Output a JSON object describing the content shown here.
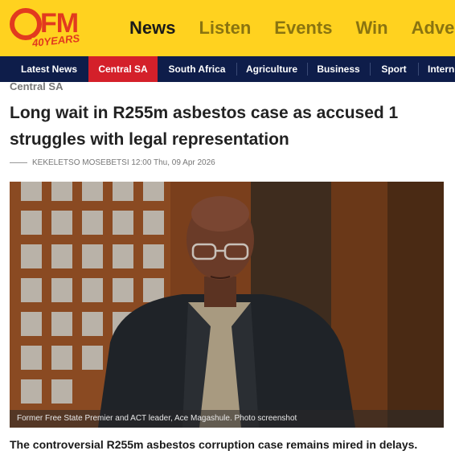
{
  "header": {
    "logo": {
      "letters": "OFM",
      "tagline": "40YEARS"
    },
    "nav": [
      {
        "label": "News",
        "active": true
      },
      {
        "label": "Listen",
        "active": false
      },
      {
        "label": "Events",
        "active": false
      },
      {
        "label": "Win",
        "active": false
      },
      {
        "label": "Adver",
        "active": false
      }
    ],
    "brand_color": "#ffd21f",
    "accent_color": "#e23a1f"
  },
  "categories": [
    {
      "label": "Latest News",
      "active": false
    },
    {
      "label": "Central SA",
      "active": true
    },
    {
      "label": "South Africa",
      "active": false
    },
    {
      "label": "Agriculture",
      "active": false
    },
    {
      "label": "Business",
      "active": false
    },
    {
      "label": "Sport",
      "active": false
    },
    {
      "label": "Intern",
      "active": false
    }
  ],
  "article": {
    "section": "Central SA",
    "headline": "Long wait in R255m asbestos case as accused 1 struggles with legal representation",
    "author": "KEKELETSO MOSEBETSI",
    "time": "12:00",
    "date": "Thu, 09 Apr 2026",
    "photo_caption": "Former Free State Premier and ACT leader, Ace Magashule. Photo screenshot",
    "lead": "The controversial R255m asbestos corruption case remains mired in delays."
  }
}
